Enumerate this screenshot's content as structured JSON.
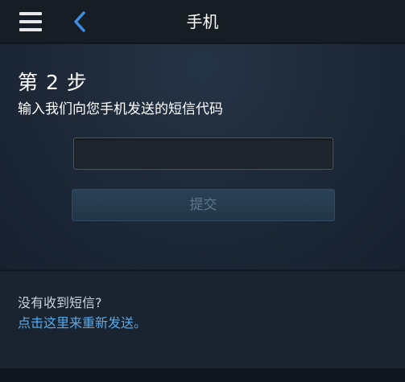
{
  "header": {
    "title": "手机",
    "menu_icon": "hamburger-icon",
    "back_icon": "chevron-left-icon"
  },
  "step": {
    "title": "第 2 步",
    "description": "输入我们向您手机发送的短信代码"
  },
  "form": {
    "code_value": "",
    "submit_label": "提交"
  },
  "footer": {
    "question": "没有收到短信?",
    "resend_link": "点击这里来重新发送。"
  },
  "colors": {
    "header_bg": "#171d25",
    "panel_bg": "#1e2a39",
    "accent_blue": "#3d8de0",
    "link_blue": "#5aa9e6",
    "button_bg": "#2a4156",
    "button_text": "#5f7689"
  }
}
